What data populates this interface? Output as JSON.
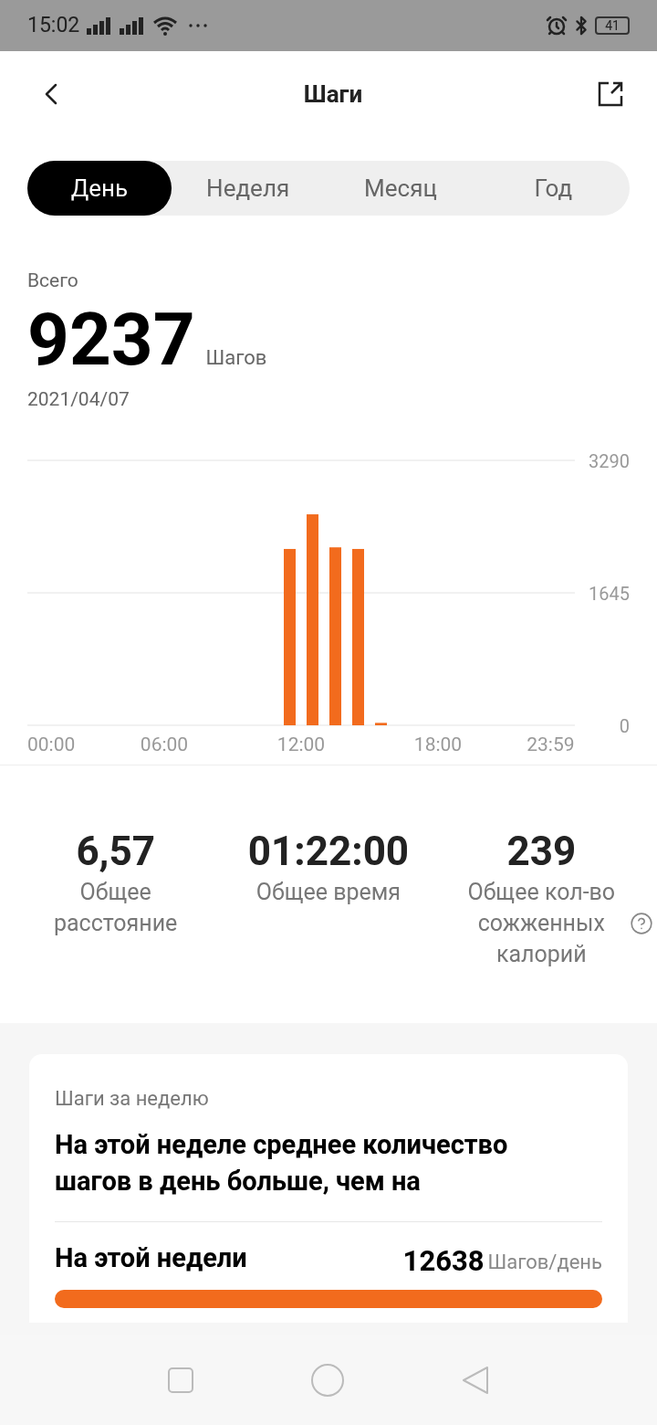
{
  "status_bar": {
    "time": "15:02",
    "battery": "41"
  },
  "header": {
    "title": "Шаги"
  },
  "tabs": [
    {
      "label": "День",
      "selected": true
    },
    {
      "label": "Неделя",
      "selected": false
    },
    {
      "label": "Месяц",
      "selected": false
    },
    {
      "label": "Год",
      "selected": false
    }
  ],
  "summary": {
    "label": "Всего",
    "value": "9237",
    "unit": "Шагов",
    "date": "2021/04/07"
  },
  "chart_data": {
    "type": "bar",
    "x": [
      11.5,
      12.5,
      13.5,
      14.5,
      15.5
    ],
    "series": [
      {
        "color": "#f26b1d",
        "values": [
          2190,
          2620,
          2210,
          2190,
          30
        ]
      }
    ],
    "xlim": [
      0,
      24
    ],
    "ylim": [
      0,
      3290
    ],
    "xticks": [
      {
        "value": 0,
        "label": "00:00"
      },
      {
        "value": 6,
        "label": "06:00"
      },
      {
        "value": 12,
        "label": "12:00"
      },
      {
        "value": 18,
        "label": "18:00"
      },
      {
        "value": 23.98,
        "label": "23:59"
      }
    ],
    "yticks": [
      0,
      1645,
      3290
    ]
  },
  "stats": [
    {
      "value": "6,57",
      "label": "Общее расстояние",
      "help": false
    },
    {
      "value": "01:22:00",
      "label": "Общее время",
      "help": false
    },
    {
      "value": "239",
      "label": "Общее кол-во сожженных калорий",
      "help": true
    }
  ],
  "weekly_card": {
    "caption": "Шаги за неделю",
    "headline": "На этой неделе среднее количество шагов в день больше, чем на",
    "rows": [
      {
        "label": "На этой недели",
        "value": "12638",
        "unit": "Шагов/день"
      }
    ]
  }
}
